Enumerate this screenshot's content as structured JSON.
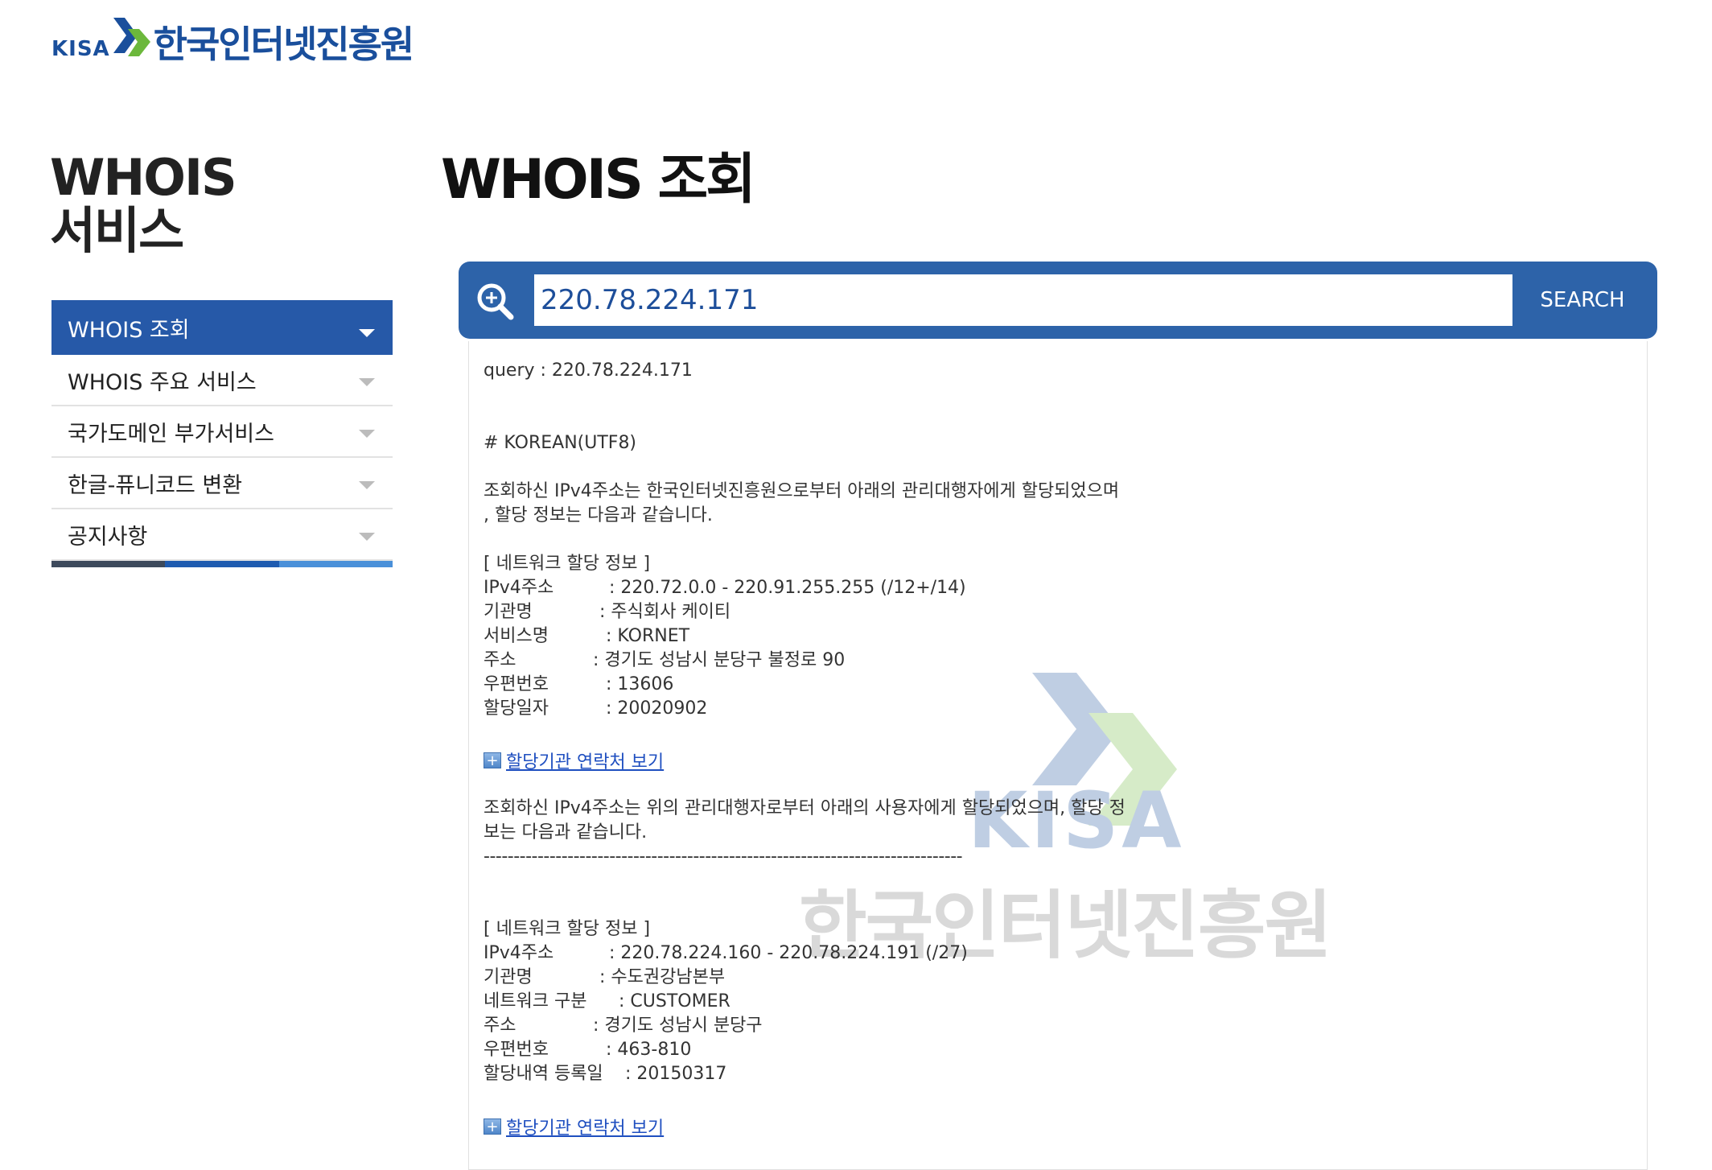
{
  "logo": {
    "kisa": "KISA",
    "name": "한국인터넷진흥원"
  },
  "sidebar": {
    "title_line1": "WHOIS",
    "title_line2": "서비스",
    "items": [
      {
        "label": "WHOIS 조회"
      },
      {
        "label": "WHOIS 주요 서비스"
      },
      {
        "label": "국가도메인 부가서비스"
      },
      {
        "label": "한글-퓨니코드 변환"
      },
      {
        "label": "공지사항"
      }
    ],
    "bar_colors": [
      "#3d4a5c",
      "#1e5bb0",
      "#4a90d9"
    ]
  },
  "main": {
    "title": "WHOIS 조회",
    "search": {
      "value": "220.78.224.171",
      "button": "SEARCH"
    }
  },
  "result": {
    "query": "query : 220.78.224.171",
    "encoding": "# KOREAN(UTF8)",
    "intro1_line1": "조회하신 IPv4주소는 한국인터넷진흥원으로부터 아래의 관리대행자에게 할당되었으며",
    "intro1_line2": ", 할당 정보는 다음과 같습니다.",
    "block1": {
      "header": "[ 네트워크 할당 정보 ]",
      "rows": [
        {
          "label": "IPv4주소",
          "value": ": 220.72.0.0 - 220.91.255.255 (/12+/14)"
        },
        {
          "label": "기관명",
          "value": ": 주식회사 케이티"
        },
        {
          "label": "서비스명",
          "value": ": KORNET"
        },
        {
          "label": "주소",
          "value": ": 경기도 성남시 분당구 불정로 90"
        },
        {
          "label": "우편번호",
          "value": ": 13606"
        },
        {
          "label": "할당일자",
          "value": ": 20020902"
        }
      ]
    },
    "contact_link": "할당기관 연락처 보기",
    "intro2_line1": "조회하신 IPv4주소는 위의 관리대행자로부터 아래의 사용자에게 할당되었으며, 할당 정",
    "intro2_line2": "보는 다음과 같습니다.",
    "separator": "--------------------------------------------------------------------------------",
    "block2": {
      "header": "[ 네트워크 할당 정보 ]",
      "rows": [
        {
          "label": "IPv4주소",
          "value": ": 220.78.224.160 - 220.78.224.191 (/27)"
        },
        {
          "label": "기관명",
          "value": ": 수도권강남본부"
        },
        {
          "label": "네트워크 구분",
          "value": ": CUSTOMER"
        },
        {
          "label": "주소",
          "value": ": 경기도 성남시 분당구"
        },
        {
          "label": "우편번호",
          "value": ": 463-810"
        },
        {
          "label": "할당내역 등록일",
          "value": ": 20150317"
        }
      ]
    },
    "contact_link2": "할당기관 연락처 보기",
    "watermark": {
      "kisa": "KISA",
      "name": "한국인터넷진흥원"
    }
  },
  "colors": {
    "brand": "#2659a8",
    "search_bg": "#2d63a9",
    "link": "#1f4fc0"
  }
}
